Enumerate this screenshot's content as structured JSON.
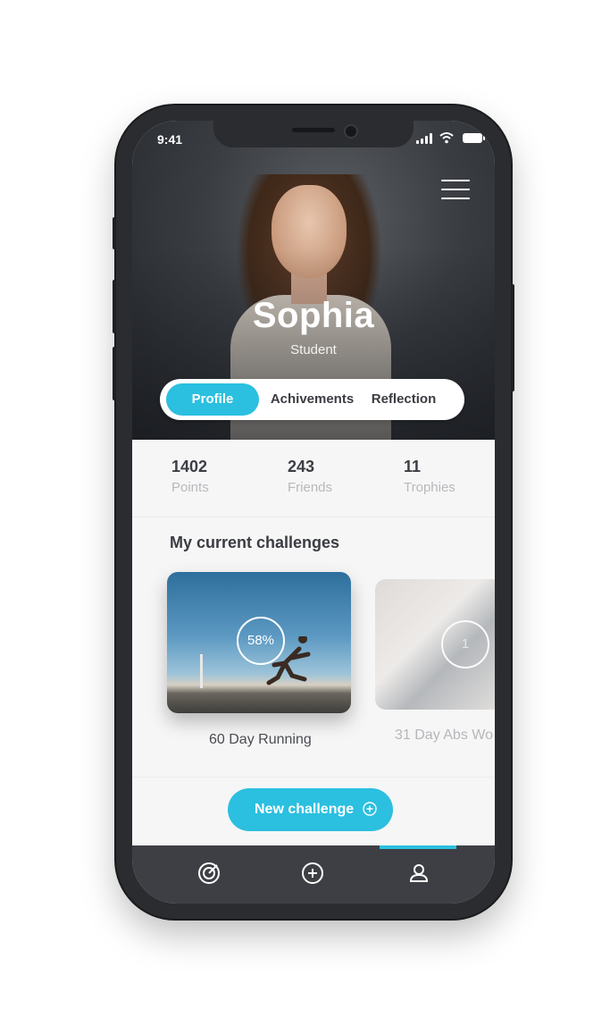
{
  "status_bar": {
    "time": "9:41"
  },
  "profile": {
    "name": "Sophia",
    "role": "Student"
  },
  "tabs": [
    {
      "label": "Profile",
      "active": true
    },
    {
      "label": "Achivements",
      "active": false
    },
    {
      "label": "Reflection",
      "active": false
    }
  ],
  "stats": [
    {
      "value": "1402",
      "label": "Points"
    },
    {
      "value": "243",
      "label": "Friends"
    },
    {
      "value": "11",
      "label": "Trophies"
    }
  ],
  "challenges_title": "My current challenges",
  "challenges": [
    {
      "label": "60 Day Running",
      "progress_text": "58%"
    },
    {
      "label": "31 Day Abs Wo",
      "progress_text": "1"
    }
  ],
  "new_challenge_label": "New challenge",
  "bottom_nav": [
    {
      "icon": "target-icon",
      "active": false
    },
    {
      "icon": "plus-circle-icon",
      "active": false
    },
    {
      "icon": "user-icon",
      "active": true
    }
  ],
  "colors": {
    "accent": "#2bbfe0",
    "dark": "#3d3f44",
    "muted": "#b7b9bd"
  }
}
